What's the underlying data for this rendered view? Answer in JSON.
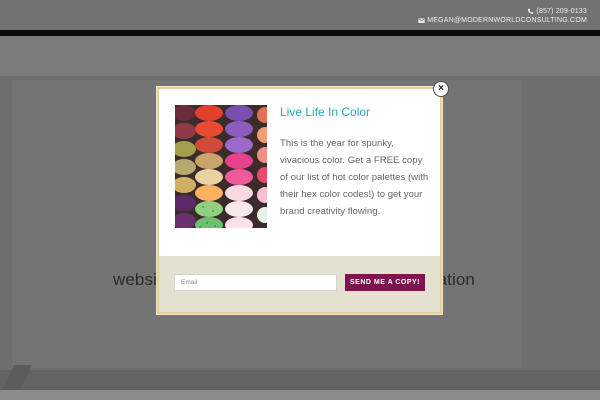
{
  "header": {
    "phone": "(857) 209-0133",
    "email": "MEGAN@MODERNWORLDCONSULTING.COM"
  },
  "hero": {
    "text_left": "websi",
    "text_right": "ation"
  },
  "popup": {
    "close_glyph": "×",
    "title": "Live Life In Color",
    "body": "This is the year for spunky, vivacious color. Get a FREE copy of our list of hot color palettes (with their hex color codes!) to get your brand creativity flowing.",
    "email_placeholder": "Email",
    "submit_label": "SEND ME A COPY!",
    "colors": {
      "title": "#1fa8c7",
      "button": "#7b1450",
      "border": "#e6cf98",
      "form_band": "#e3e2d0"
    }
  }
}
